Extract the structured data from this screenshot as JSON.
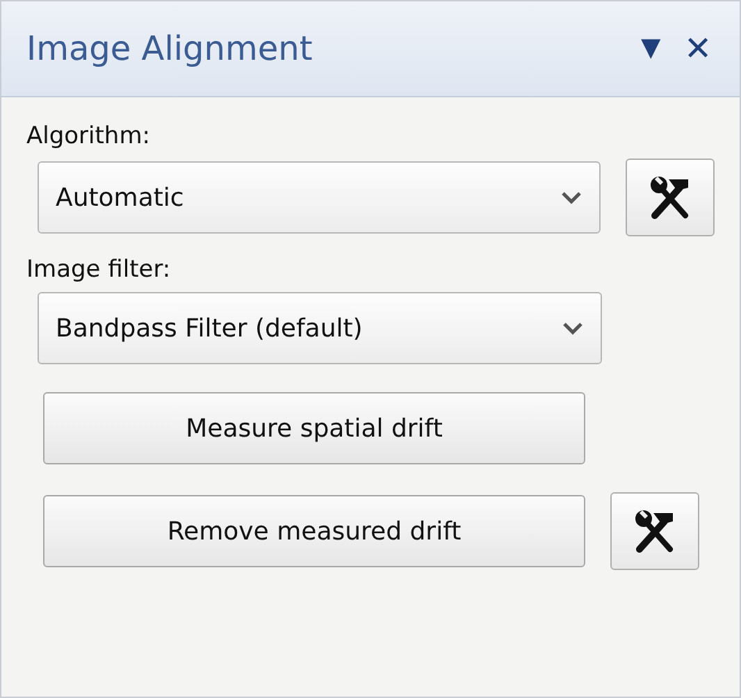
{
  "panel": {
    "title": "Image Alignment",
    "menu_glyph": "▼",
    "close_glyph": "✕"
  },
  "fields": [
    {
      "label": "Algorithm:",
      "value": "Automatic",
      "has_tools": true
    },
    {
      "label": "Image filter:",
      "value": "Bandpass Filter (default)",
      "has_tools": false
    }
  ],
  "buttons": [
    {
      "label": "Measure spatial drift",
      "has_tools": false
    },
    {
      "label": "Remove measured drift",
      "has_tools": true
    }
  ]
}
